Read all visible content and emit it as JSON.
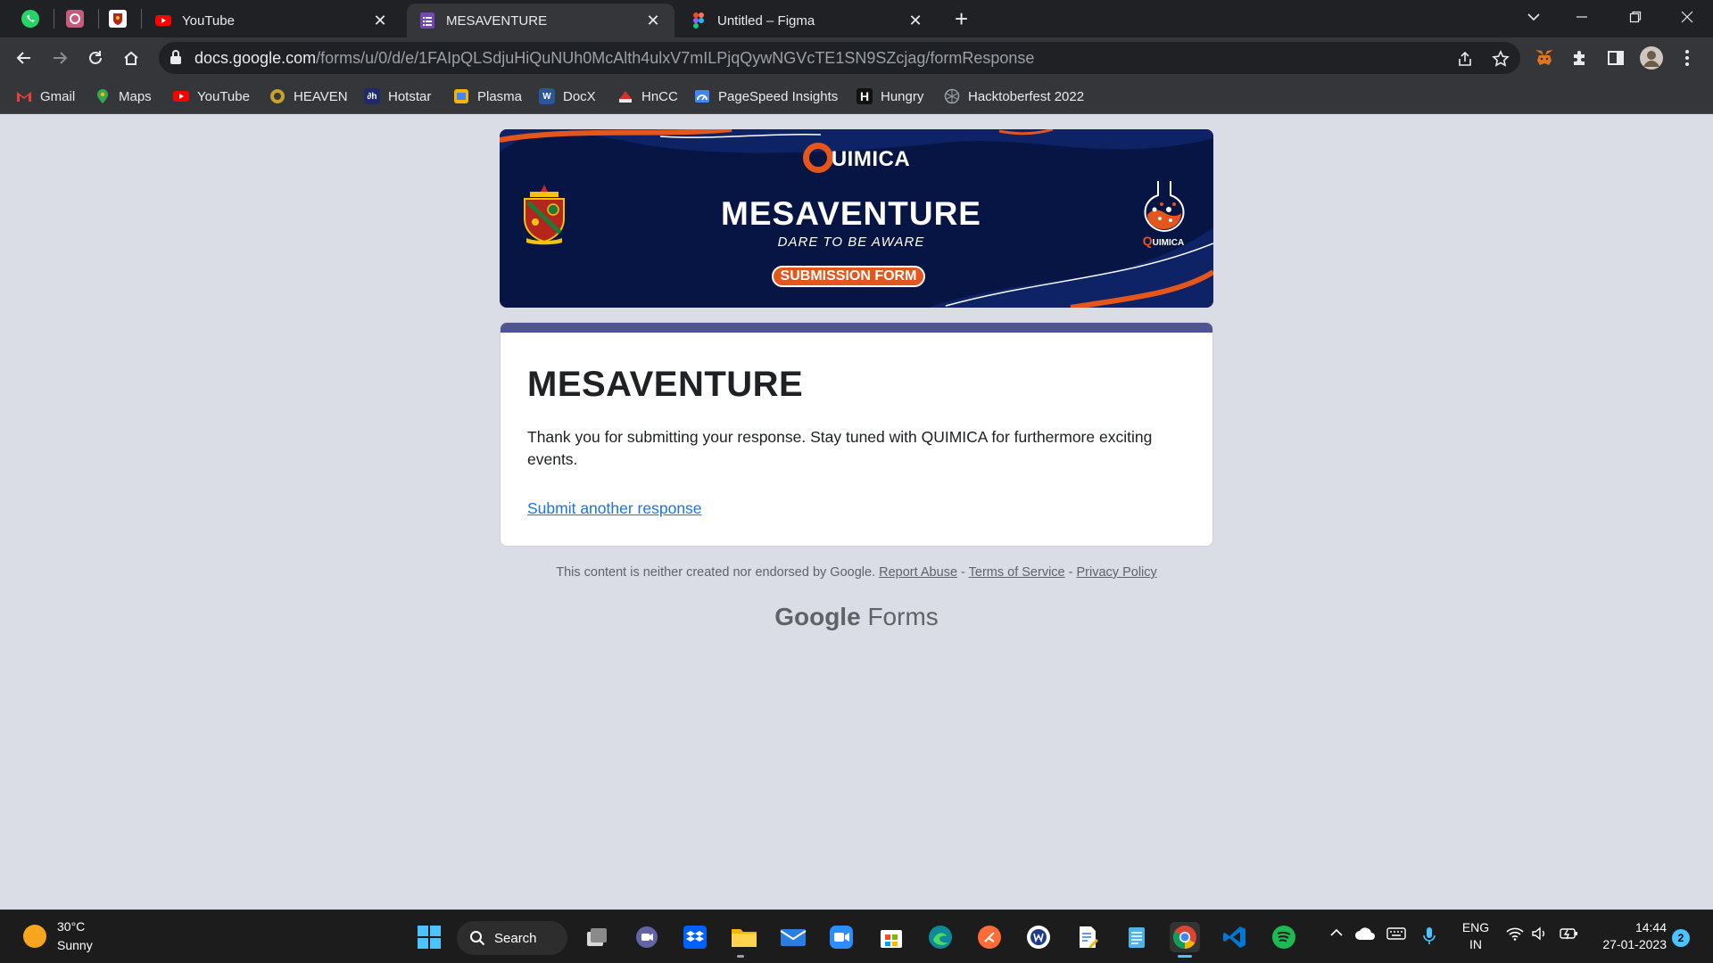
{
  "browser": {
    "tabs": [
      {
        "title": "YouTube",
        "favicon": "youtube-icon",
        "active": false
      },
      {
        "title": "MESAVENTURE",
        "favicon": "google-forms-icon",
        "active": true
      },
      {
        "title": "Untitled – Figma",
        "favicon": "figma-icon",
        "active": false
      }
    ],
    "pinned_tabs": [
      "whatsapp-icon",
      "app-icon",
      "crest-icon"
    ],
    "url_host": "docs.google.com",
    "url_path": "/forms/u/0/d/e/1FAIpQLSdjuHiQuNUh0McAlth4ulxV7mILPjqQywNGVcTE1SN9SZcjag/formResponse",
    "bookmarks": [
      {
        "label": "Gmail",
        "icon": "gmail-icon",
        "color": "#ea4335"
      },
      {
        "label": "Maps",
        "icon": "maps-icon",
        "color": "#34a853"
      },
      {
        "label": "YouTube",
        "icon": "youtube-icon",
        "color": "#ff0000"
      },
      {
        "label": "HEAVEN",
        "icon": "heaven-icon",
        "color": "#c9a227"
      },
      {
        "label": "Hotstar",
        "icon": "hotstar-icon",
        "color": "#1f2a6b"
      },
      {
        "label": "Plasma",
        "icon": "plasma-icon",
        "color": "#f4b400"
      },
      {
        "label": "DocX",
        "icon": "word-icon",
        "color": "#2b579a"
      },
      {
        "label": "HnCC",
        "icon": "hncc-icon",
        "color": "#d93025"
      },
      {
        "label": "PageSpeed Insights",
        "icon": "pagespeed-icon",
        "color": "#4285f4"
      },
      {
        "label": "Hungry",
        "icon": "hungry-icon",
        "color": "#111111"
      },
      {
        "label": "Hacktoberfest 2022",
        "icon": "hacktoberfest-icon",
        "color": "#9aa0a6"
      }
    ]
  },
  "banner": {
    "brand": "UIMICA",
    "title": "MESAVENTURE",
    "tagline": "DARE TO BE AWARE",
    "pill": "SUBMISSION FORM",
    "flask_brand": "UIMICA",
    "flask_brand_q": "Q"
  },
  "form": {
    "title": "MESAVENTURE",
    "message": "Thank you for submitting your response. Stay tuned with QUIMICA for furthermore exciting events.",
    "submit_another": "Submit another response"
  },
  "footer": {
    "disclaimer": "This content is neither created nor endorsed by Google.",
    "report_abuse": "Report Abuse",
    "sep": " - ",
    "terms": "Terms of Service",
    "privacy": "Privacy Policy",
    "logo_google": "Google",
    "logo_forms": "Forms"
  },
  "taskbar": {
    "weather_temp": "30°C",
    "weather_cond": "Sunny",
    "search_label": "Search",
    "lang_1": "ENG",
    "lang_2": "IN",
    "time": "14:44",
    "date": "27-01-2023",
    "notifications": "2"
  },
  "colors": {
    "banner_bg": "#071544",
    "accent_orange": "#e4561b",
    "form_accent": "#4f5590",
    "link_blue": "#1a73e8",
    "page_bg": "#dadce6"
  }
}
